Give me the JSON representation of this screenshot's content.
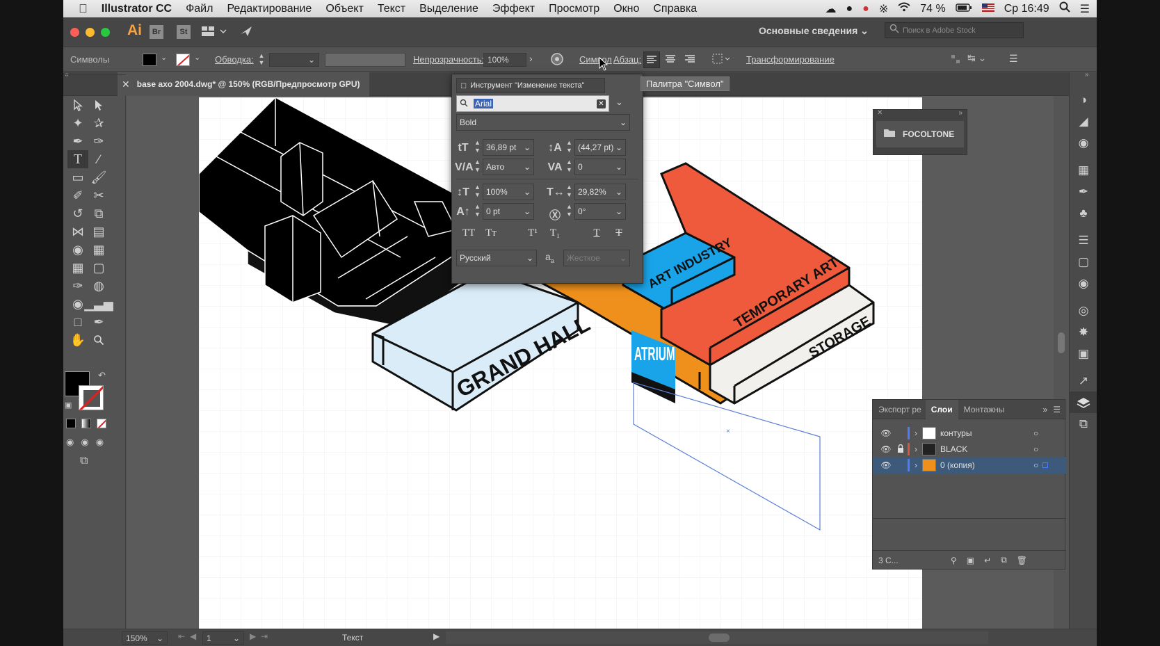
{
  "menubar": {
    "apple": "",
    "app_name": "Illustrator CC",
    "items": [
      "Файл",
      "Редактирование",
      "Объект",
      "Текст",
      "Выделение",
      "Эффект",
      "Просмотр",
      "Окно",
      "Справка"
    ],
    "battery": "74 %",
    "clock": "Ср 16:49"
  },
  "appbar": {
    "logo": "Ai",
    "br": "Br",
    "st": "St",
    "workspace": "Основные сведения",
    "stock_search_placeholder": "Поиск в Adobe Stock"
  },
  "control": {
    "context": "Символы",
    "stroke_label": "Обводка:",
    "opacity_label": "Непрозрачность:",
    "opacity_value": "100%",
    "symbol_link": "Символ",
    "paragraph_label": "Абзац:",
    "transform_link": "Трансформирование"
  },
  "document_tab": {
    "title": "base axo 2004.dwg* @ 150% (RGB/Предпросмотр GPU)"
  },
  "tooltip": "Палитра \"Символ\"",
  "char_panel": {
    "touch_type": "Инструмент \"Изменение текста\"",
    "font_family": "Arial",
    "font_style": "Bold",
    "font_size": "36,89 pt",
    "leading": "(44,27 pt)",
    "kerning": "Авто",
    "tracking": "0",
    "vertical_scale": "100%",
    "horizontal_scale": "29,82%",
    "baseline_shift": "0 pt",
    "rotation": "0°",
    "case_buttons": [
      "TT",
      "Tт",
      "T¹",
      "T₁",
      "T",
      "T"
    ],
    "language": "Русский",
    "aa_label": "a",
    "anti_alias": "Жесткое"
  },
  "focoltone": {
    "label": "FOCOLTONE"
  },
  "layers_panel": {
    "tabs": [
      "Экспорт ре",
      "Слои",
      "Монтажны"
    ],
    "active_tab": "Слои",
    "rows": [
      {
        "name": "контуры",
        "color": "#4f7bff",
        "locked": false
      },
      {
        "name": "BLACK",
        "color": "#e0543f",
        "locked": true
      },
      {
        "name": "0 (копия)",
        "color": "#4f7bff",
        "locked": false
      }
    ],
    "footer_count": "3 С..."
  },
  "status": {
    "zoom": "150%",
    "page": "1",
    "tool": "Текст"
  },
  "artwork": {
    "grand_hall": "GRAND HALL",
    "atrium": "ATRIUM",
    "art_industry": "ART INDUSTRY",
    "temporary_art": "TEMPORARY ART",
    "storage": "STORAGE"
  },
  "colors": {
    "orange": "#f0901c",
    "red": "#ee5a3b",
    "blue": "#19a3e8",
    "light_blue": "#d9ecf7",
    "yellow": "#f6c71f",
    "storage": "#f2f0ec",
    "selection": "#5b7fd6"
  }
}
